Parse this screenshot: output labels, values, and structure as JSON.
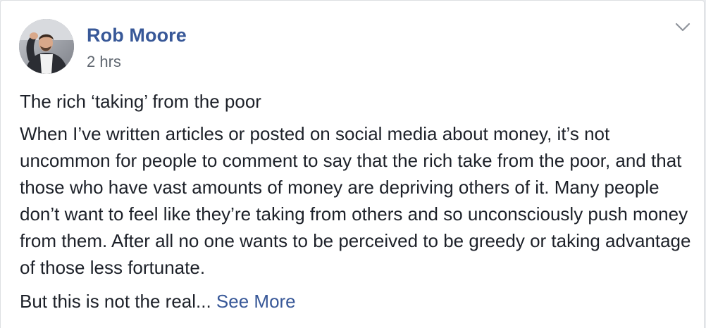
{
  "post": {
    "author": "Rob Moore",
    "timestamp": "2 hrs",
    "title": "The rich ‘taking’ from the poor",
    "body": "When I’ve written articles or posted on social media about money, it’s not uncommon for people to comment to say that the rich take from the poor, and that those who have vast amounts of money are depriving others of it. Many people don’t want to feel like they’re taking from others and so unconsciously push money from them. After all no one wants to be perceived to be greedy or taking advantage of those less fortunate.",
    "truncated_text": "But this is not the real... ",
    "see_more_label": "See More"
  },
  "icons": {
    "avatar": "profile-photo",
    "menu": "chevron-down-icon"
  },
  "colors": {
    "link": "#385898",
    "text": "#1d2129",
    "secondary_text": "#606770",
    "card_border": "#dddfe2"
  }
}
